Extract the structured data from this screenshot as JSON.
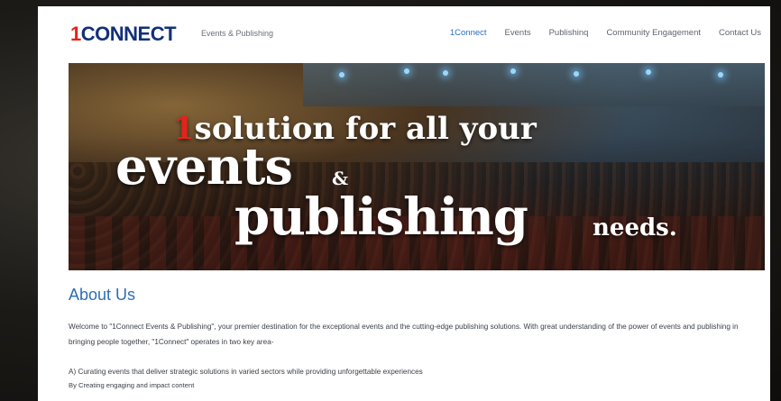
{
  "header": {
    "logo": {
      "one": "1",
      "rest": "CONNECT"
    },
    "tagline": "Events & Publishing",
    "nav": [
      {
        "label": "1Connect",
        "active": true
      },
      {
        "label": "Events",
        "active": false
      },
      {
        "label": "Publishinq",
        "active": false
      },
      {
        "label": "Community Engagement",
        "active": false
      },
      {
        "label": "Contact Us",
        "active": false
      }
    ]
  },
  "hero": {
    "line1_one": "1",
    "line1_rest": "solution for all your",
    "line2": "events",
    "amp": "&",
    "line3": "publishing",
    "line4": "needs."
  },
  "about": {
    "title": "About Us",
    "paragraph": "Welcome to \"1Connect Events & Publishing\", your premier destination for the exceptional events and the cutting-edge publishing solutions. With great understanding of the power of events and publishing in bringing people together, \"1Connect\" operates in two key area-",
    "point_a": "A) Curating events that deliver strategic solutions in varied sectors while providing unforgettable experiences",
    "point_b": "By Creating engaging and impact content"
  },
  "colors": {
    "brand_red": "#e3231c",
    "brand_navy": "#12307a",
    "link_blue": "#2b6fc0",
    "heading_blue": "#2f6db5"
  }
}
